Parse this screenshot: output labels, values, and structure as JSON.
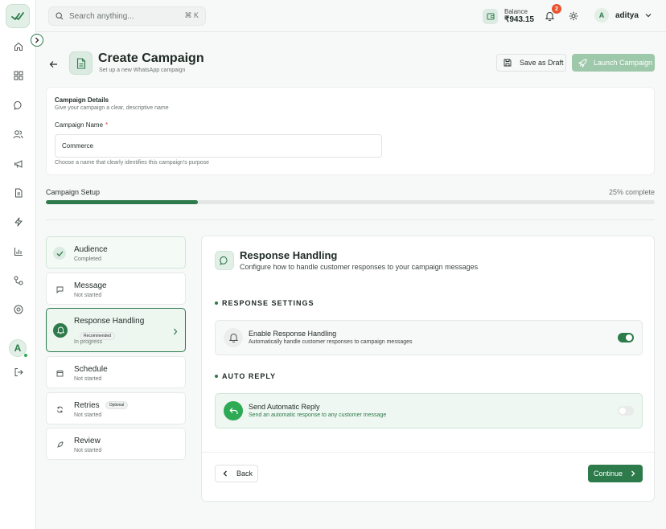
{
  "header": {
    "search_placeholder": "Search anything...",
    "search_shortcut": "⌘ K",
    "balance_label": "Balance",
    "balance_amount": "₹943.15",
    "notification_count": "2",
    "user_initial": "A",
    "user_name": "aditya"
  },
  "sidebar": {
    "items": [
      "home-icon",
      "grid-icon",
      "chat-icon",
      "users-icon",
      "megaphone-icon",
      "document-icon",
      "zap-icon",
      "bar-chart-icon",
      "workflow-icon",
      "help-icon"
    ],
    "avatar_initial": "A"
  },
  "page": {
    "title": "Create Campaign",
    "subtitle": "Set up a new WhatsApp campaign",
    "save_draft": "Save as Draft",
    "launch": "Launch Campaign"
  },
  "details": {
    "heading": "Campaign Details",
    "description": "Give your campaign a clear, descriptive name",
    "field_label": "Campaign Name",
    "required_mark": "*",
    "field_value": "Commerce",
    "help": "Choose a name that clearly identifies this campaign's purpose"
  },
  "progress": {
    "label": "Campaign Setup",
    "percent_text": "25% complete",
    "value": 0.25
  },
  "steps": [
    {
      "title": "Audience",
      "status": "Completed",
      "tag": ""
    },
    {
      "title": "Message",
      "status": "Not started",
      "tag": ""
    },
    {
      "title": "Response Handling",
      "status": "In progress",
      "tag": "Recommended"
    },
    {
      "title": "Schedule",
      "status": "Not started",
      "tag": ""
    },
    {
      "title": "Retries",
      "status": "Not started",
      "tag": "Optional"
    },
    {
      "title": "Review",
      "status": "Not started",
      "tag": ""
    }
  ],
  "response": {
    "title": "Response Handling",
    "subtitle": "Configure how to handle customer responses to your campaign messages",
    "section1": "RESPONSE SETTINGS",
    "opt1_title": "Enable Response Handling",
    "opt1_sub": "Automatically handle customer responses to campaign messages",
    "opt1_enabled": true,
    "section2": "AUTO REPLY",
    "opt2_title": "Send Automatic Reply",
    "opt2_sub": "Send an automatic response to any customer message",
    "opt2_enabled": false,
    "back": "Back",
    "continue": "Continue"
  },
  "colors": {
    "brand": "#2d7a4b",
    "accent_light": "#e2efe6",
    "badge": "#e8542f"
  }
}
